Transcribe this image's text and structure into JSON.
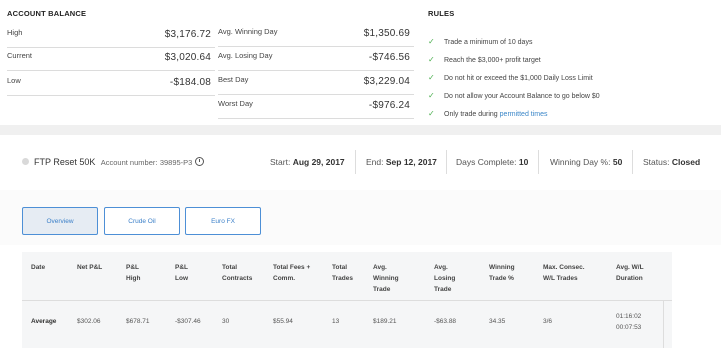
{
  "balance": {
    "title": "ACCOUNT BALANCE",
    "left": [
      {
        "label": "High",
        "value": "$3,176.72"
      },
      {
        "label": "Current",
        "value": "$3,020.64"
      },
      {
        "label": "Low",
        "value": "-$184.08"
      }
    ],
    "right": [
      {
        "label": "Avg. Winning Day",
        "value": "$1,350.69"
      },
      {
        "label": "Avg. Losing Day",
        "value": "-$746.56"
      },
      {
        "label": "Best Day",
        "value": "$3,229.04"
      },
      {
        "label": "Worst Day",
        "value": "-$976.24"
      }
    ]
  },
  "rules": {
    "title": "RULES",
    "items": [
      "Trade a minimum of 10 days",
      "Reach the $3,000+ profit target",
      "Do not hit or exceed the $1,000 Daily Loss Limit",
      "Do not allow your Account Balance to go below $0"
    ],
    "last_prefix": "Only trade during ",
    "last_link": "permitted times"
  },
  "account": {
    "name": "FTP Reset 50K",
    "number_label": "Account number:",
    "number": "39895-P3",
    "start_label": "Start:",
    "start": "Aug 29, 2017",
    "end_label": "End:",
    "end": "Sep 12, 2017",
    "days_label": "Days Complete:",
    "days": "10",
    "winning_label": "Winning Day %:",
    "winning": "50",
    "status_label": "Status:",
    "status": "Closed"
  },
  "tabs": [
    "Overview",
    "Crude Oil",
    "Euro FX"
  ],
  "table": {
    "headers": [
      [
        "Date"
      ],
      [
        "Net P&L"
      ],
      [
        "P&L",
        "High"
      ],
      [
        "P&L",
        "Low"
      ],
      [
        "Total",
        "Contracts"
      ],
      [
        "Total Fees +",
        "Comm."
      ],
      [
        "Total",
        "Trades"
      ],
      [
        "Avg.",
        "Winning",
        "Trade"
      ],
      [
        "Avg.",
        "Losing",
        "Trade"
      ],
      [
        "Winning",
        "Trade %"
      ],
      [
        "Max. Consec.",
        "W/L Trades"
      ],
      [
        "Avg. W/L",
        "Duration"
      ]
    ],
    "row": {
      "date": "Average",
      "net_pnl": "$302.06",
      "pnl_high": "$678.71",
      "pnl_low": "-$307.46",
      "contracts": "30",
      "fees": "$55.94",
      "trades": "13",
      "avg_win": "$189.21",
      "avg_loss": "-$63.88",
      "win_pct": "34.35",
      "max_consec": "3/6",
      "duration_win": "01:16:02",
      "duration_loss": "00:07:53"
    }
  },
  "colors": {
    "check": "#4caf50",
    "link": "#3a86c8",
    "tab_border": "#4d8fd6"
  }
}
